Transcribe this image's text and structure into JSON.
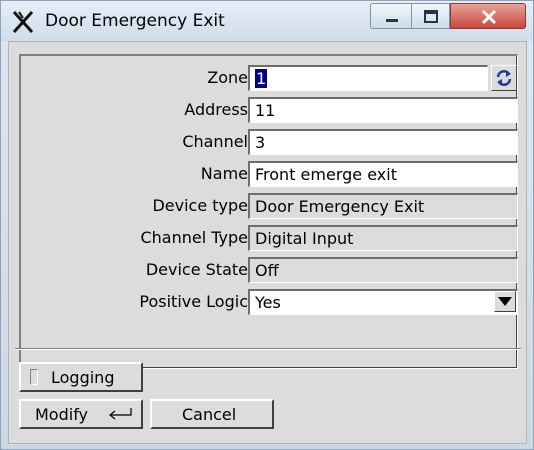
{
  "window": {
    "title": "Door Emergency Exit",
    "icon": "app-x-icon"
  },
  "form": {
    "zone": {
      "label": "Zone",
      "value": "1"
    },
    "address": {
      "label": "Address",
      "value": "11"
    },
    "channel": {
      "label": "Channel",
      "value": "3"
    },
    "name": {
      "label": "Name",
      "value": "Front emerge exit"
    },
    "device_type": {
      "label": "Device type",
      "value": "Door Emergency Exit"
    },
    "channel_type": {
      "label": "Channel Type",
      "value": "Digital Input"
    },
    "device_state": {
      "label": "Device State",
      "value": "Off"
    },
    "positive_logic": {
      "label": "Positive Logic",
      "value": "Yes"
    }
  },
  "buttons": {
    "logging": "Logging",
    "modify": "Modify",
    "cancel": "Cancel"
  },
  "colors": {
    "selection": "#000080",
    "close_button": "#c9463c"
  }
}
